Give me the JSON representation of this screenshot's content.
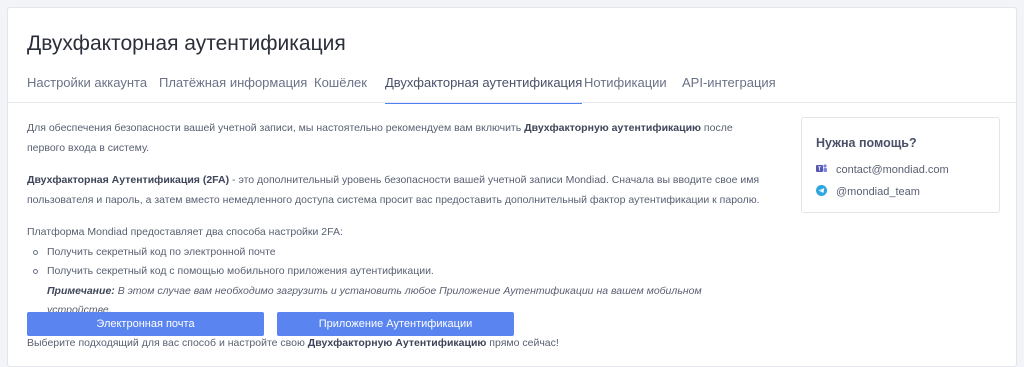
{
  "page": {
    "title": "Двухфакторная аутентификация"
  },
  "tabs": [
    {
      "label": "Настройки аккаунта"
    },
    {
      "label": "Платёжная информация"
    },
    {
      "label": "Кошёлек"
    },
    {
      "label": "Двухфакторная аутентификация",
      "active": true
    },
    {
      "label": "Нотификации"
    },
    {
      "label": "API-интеграция"
    }
  ],
  "content": {
    "intro_a": "Для обеспечения безопасности вашей учетной записи, мы настоятельно рекомендуем вам включить ",
    "intro_b": "Двухфакторную аутентификацию",
    "intro_c": " после первого входа в систему.",
    "twofa_a": "Двухфакторная Аутентификация (2FA)",
    "twofa_b": " - это дополнительный уровень безопасности вашей учетной записи Mondiad. Сначала вы вводите свое имя пользователя и пароль, а затем вместо немедленного доступа система просит вас предоставить дополнительный фактор аутентификации к паролю.",
    "methods_intro": "Платформа Mondiad предоставляет два способа настройки 2FA:",
    "method_1": "Получить секретный код по электронной почте",
    "method_2": "Получить секретный код с помощью мобильного приложения аутентификации.",
    "note_label": "Примечание:",
    "note_text": " В этом случае вам необходимо загрузить и установить любое Приложение Аутентификации на вашем мобильном устройстве.",
    "choose_a": "Выберите подходящий для вас способ и настройте свою ",
    "choose_b": "Двухфакторную Аутентификацию",
    "choose_c": " прямо сейчас!"
  },
  "buttons": {
    "email": "Электронная почта",
    "app": "Приложение Аутентификации"
  },
  "help": {
    "title": "Нужна помощь?",
    "email_icon": "teams-icon",
    "email": "contact@mondiad.com",
    "telegram_icon": "telegram-icon",
    "telegram": "@mondiad_team"
  },
  "colors": {
    "accent": "#4f7ff3",
    "button": "#5a84f0",
    "telegram": "#2ea6df",
    "teams": "#5558af"
  }
}
